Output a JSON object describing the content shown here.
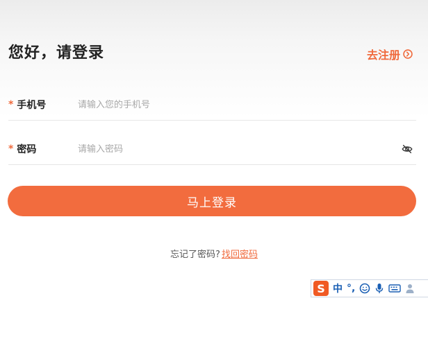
{
  "header": {
    "title": "您好，请登录",
    "register_label": "去注册"
  },
  "form": {
    "phone": {
      "label": "手机号",
      "required_mark": "*",
      "placeholder": "请输入您的手机号",
      "value": ""
    },
    "password": {
      "label": "密码",
      "required_mark": "*",
      "placeholder": "请输入密码",
      "value": "",
      "visibility_icon": "eye-off-icon"
    },
    "submit_label": "马上登录"
  },
  "forgot": {
    "prompt": "忘记了密码?",
    "link_label": "找回密码"
  },
  "ime_toolbar": {
    "logo": "S",
    "mode_label": "中",
    "punctuation_label": "°,",
    "icons": [
      "smiley-icon",
      "microphone-icon",
      "keyboard-icon",
      "user-icon"
    ]
  },
  "colors": {
    "accent": "#f26c3e",
    "title": "#222222",
    "placeholder": "#a8a8a8"
  }
}
